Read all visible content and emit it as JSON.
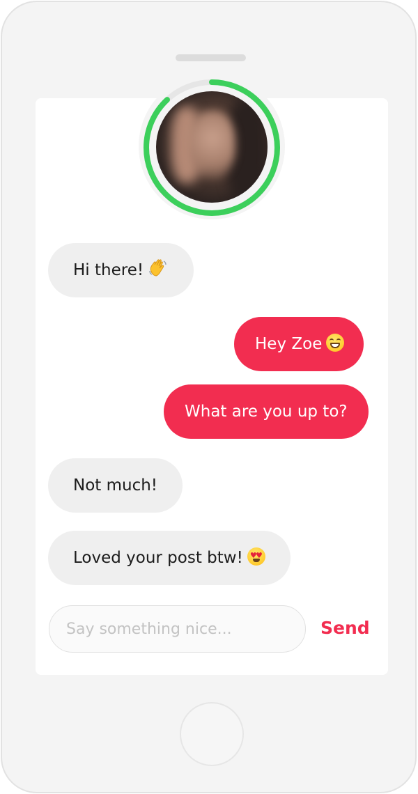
{
  "contact": {
    "name": "Zoe",
    "avatar": "profile-photo",
    "story_ring_color": "#3ccf5b"
  },
  "messages": [
    {
      "from": "them",
      "text": "Hi there!",
      "emoji": "waving-hand"
    },
    {
      "from": "me",
      "text": "Hey Zoe",
      "emoji": "grinning-face"
    },
    {
      "from": "me",
      "text": "What are you up to?"
    },
    {
      "from": "them",
      "text": "Not much!"
    },
    {
      "from": "them",
      "text": "Loved your post btw!",
      "emoji": "heart-eyes-face"
    }
  ],
  "composer": {
    "placeholder": "Say something nice...",
    "value": "",
    "send_label": "Send"
  },
  "colors": {
    "accent": "#f22d50",
    "incoming_bubble": "#efefef",
    "ring": "#3ccf5b"
  }
}
